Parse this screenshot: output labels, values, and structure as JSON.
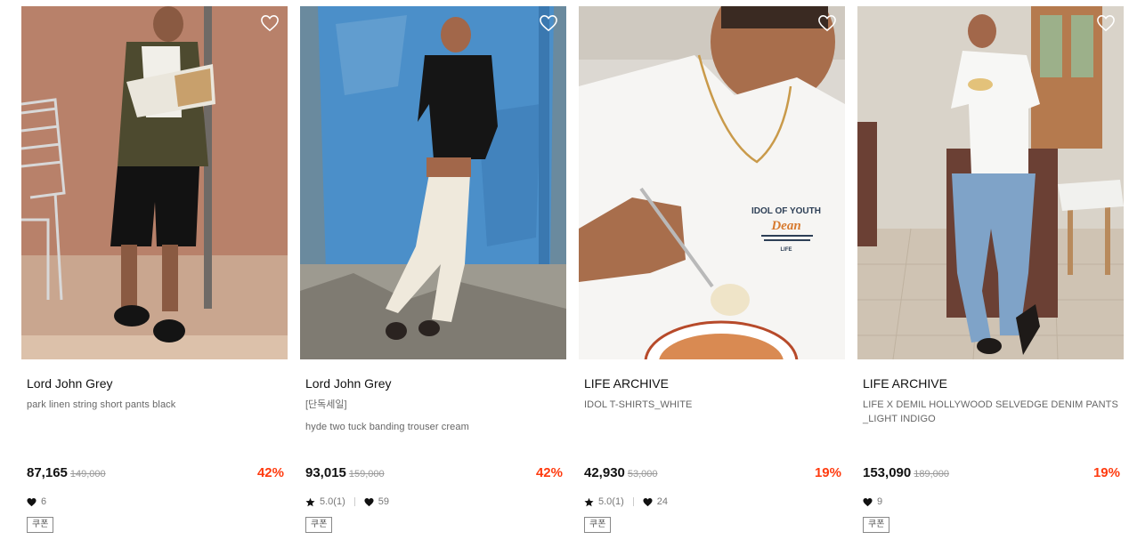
{
  "products": [
    {
      "brand": "Lord John Grey",
      "tagline": "",
      "name": "park linen string short pants black",
      "price": "87,165",
      "original_price": "149,000",
      "discount": "42%",
      "rating": "",
      "likes": "6",
      "coupon": "쿠폰"
    },
    {
      "brand": "Lord John Grey",
      "tagline": "[단독세일]",
      "name": "hyde two tuck banding trouser cream",
      "price": "93,015",
      "original_price": "159,000",
      "discount": "42%",
      "rating": "5.0(1)",
      "likes": "59",
      "coupon": "쿠폰"
    },
    {
      "brand": "LIFE ARCHIVE",
      "tagline": "",
      "name": "IDOL T-SHIRTS_WHITE",
      "price": "42,930",
      "original_price": "53,000",
      "discount": "19%",
      "rating": "5.0(1)",
      "likes": "24",
      "coupon": "쿠폰"
    },
    {
      "brand": "LIFE ARCHIVE",
      "tagline": "",
      "name": "LIFE X DEMIL HOLLYWOOD SELVEDGE DENIM PANTS _LIGHT INDIGO",
      "price": "153,090",
      "original_price": "189,000",
      "discount": "19%",
      "rating": "",
      "likes": "9",
      "coupon": "쿠폰"
    }
  ],
  "tshirt_print": {
    "line1": "IDOL OF YOUTH",
    "line2": "Dean",
    "line3": "LIFE"
  },
  "icons": {
    "wishlist": "heart-outline-icon",
    "likes": "heart-filled-icon",
    "rating": "star-icon"
  },
  "colors": {
    "discount": "#ff3b0f",
    "price": "#111111",
    "muted": "#777777"
  }
}
